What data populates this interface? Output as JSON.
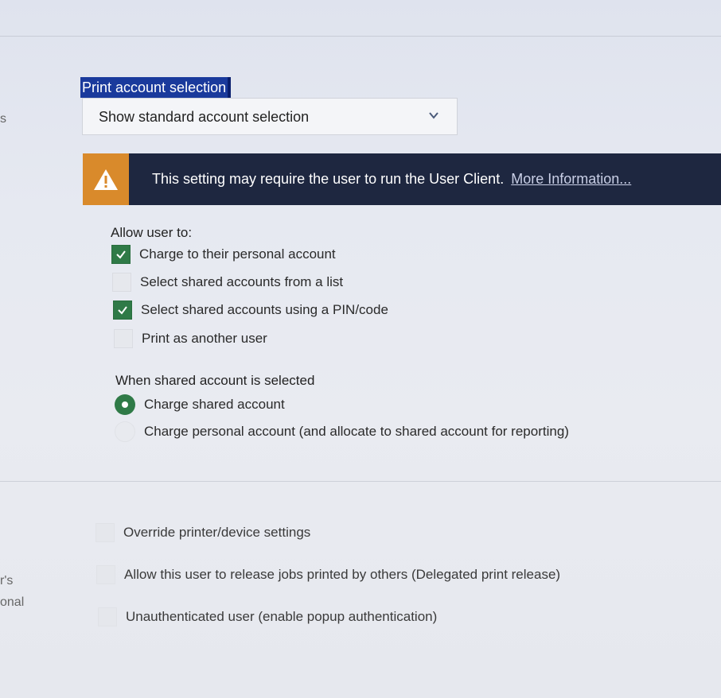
{
  "left_fragments": {
    "s": "s",
    "rs": "r's",
    "onal": "onal"
  },
  "print_account": {
    "section_label": "Print account selection",
    "select_value": "Show standard account selection"
  },
  "banner": {
    "message": "This setting may require the user to run the User Client.",
    "link": "More Information..."
  },
  "allow_user": {
    "title": "Allow user to:",
    "options": [
      {
        "label": "Charge to their personal account",
        "checked": true
      },
      {
        "label": "Select shared accounts from a list",
        "checked": false
      },
      {
        "label": "Select shared accounts using a PIN/code",
        "checked": true
      },
      {
        "label": "Print as another user",
        "checked": false
      }
    ]
  },
  "shared_account": {
    "title": "When shared account is selected",
    "options": [
      {
        "label": "Charge shared account",
        "selected": true
      },
      {
        "label": "Charge personal account (and allocate to shared account for reporting)",
        "selected": false
      }
    ]
  },
  "other_settings": [
    {
      "label": "Override printer/device settings",
      "checked": false
    },
    {
      "label": "Allow this user to release jobs printed by others (Delegated print release)",
      "checked": false
    },
    {
      "label": "Unauthenticated user (enable popup authentication)",
      "checked": false
    }
  ],
  "colors": {
    "check_green": "#2f7a47",
    "banner_dark": "#1e2740",
    "warning_orange": "#d98a2b",
    "label_highlight": "#1a3a9c"
  }
}
